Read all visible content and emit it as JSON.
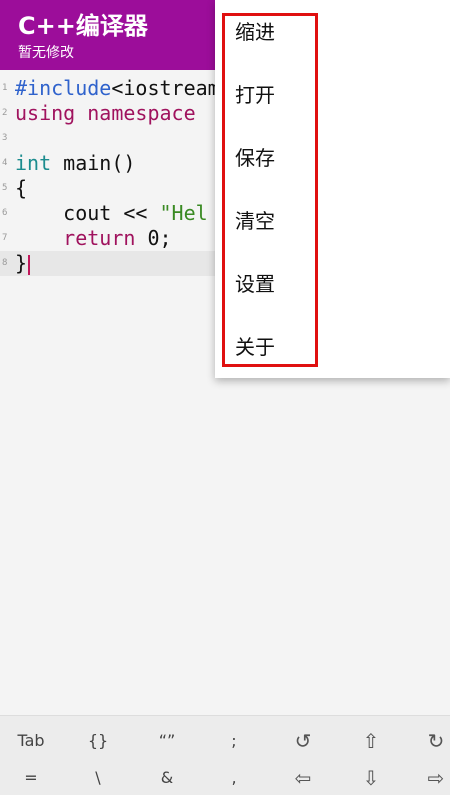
{
  "appbar": {
    "title": "C++编译器",
    "subtitle": "暂无修改",
    "color": "#9c0d9a"
  },
  "editor": {
    "lines": [
      {
        "num": "1",
        "tokens": [
          {
            "t": "#include",
            "c": "dir"
          },
          {
            "t": "<iostream",
            "c": ""
          }
        ]
      },
      {
        "num": "2",
        "tokens": [
          {
            "t": "using namespace",
            "c": "kw"
          }
        ]
      },
      {
        "num": "3",
        "tokens": []
      },
      {
        "num": "4",
        "tokens": [
          {
            "t": "int",
            "c": "type"
          },
          {
            "t": " main()",
            "c": ""
          }
        ]
      },
      {
        "num": "5",
        "tokens": [
          {
            "t": "{",
            "c": ""
          }
        ]
      },
      {
        "num": "6",
        "tokens": [
          {
            "t": "    cout << ",
            "c": ""
          },
          {
            "t": "\"Hel",
            "c": "str"
          }
        ]
      },
      {
        "num": "7",
        "tokens": [
          {
            "t": "    ",
            "c": ""
          },
          {
            "t": "return",
            "c": "kw"
          },
          {
            "t": " 0;",
            "c": ""
          }
        ]
      },
      {
        "num": "8",
        "tokens": [
          {
            "t": "}",
            "c": ""
          }
        ],
        "current": true
      }
    ]
  },
  "menu": {
    "items": [
      "缩进",
      "打开",
      "保存",
      "清空",
      "设置",
      "关于"
    ],
    "highlight_color": "#e01010"
  },
  "keybar": {
    "row1": [
      {
        "label": "Tab",
        "icon": "tab-key"
      },
      {
        "label": "{}",
        "icon": "braces-key"
      },
      {
        "label": "“”",
        "icon": "quotes-key"
      },
      {
        "label": ";",
        "icon": "semicolon-key"
      },
      {
        "label": "↺",
        "icon": "undo-icon"
      },
      {
        "label": "⇧",
        "icon": "arrow-up-icon"
      },
      {
        "label": "↻",
        "icon": "redo-icon"
      }
    ],
    "row2": [
      {
        "label": "=",
        "icon": "equals-key"
      },
      {
        "label": "\\",
        "icon": "backslash-key"
      },
      {
        "label": "&",
        "icon": "ampersand-key"
      },
      {
        "label": ",",
        "icon": "comma-key"
      },
      {
        "label": "⇦",
        "icon": "arrow-left-icon"
      },
      {
        "label": "⇩",
        "icon": "arrow-down-icon"
      },
      {
        "label": "⇨",
        "icon": "arrow-right-icon"
      }
    ]
  }
}
